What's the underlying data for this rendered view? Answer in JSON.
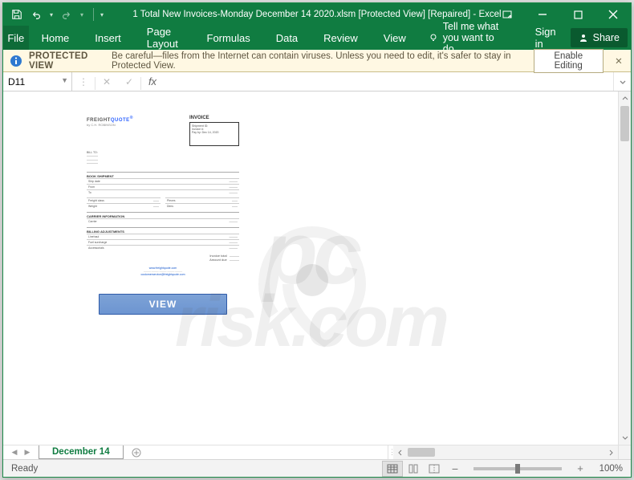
{
  "titlebar": {
    "title": "1 Total New Invoices-Monday December 14 2020.xlsm  [Protected View] [Repaired] - Excel"
  },
  "ribbon": {
    "file": "File",
    "tabs": [
      "Home",
      "Insert",
      "Page Layout",
      "Formulas",
      "Data",
      "Review",
      "View"
    ],
    "tell_me": "Tell me what you want to do...",
    "sign_in": "Sign in",
    "share": "Share"
  },
  "protected_view": {
    "strong": "PROTECTED VIEW",
    "message": "Be careful—files from the Internet can contain viruses. Unless you need to edit, it's safer to stay in Protected View.",
    "enable": "Enable Editing"
  },
  "formula": {
    "name_box": "D11",
    "fx": "fx"
  },
  "sheet": {
    "active_tab": "December 14"
  },
  "status": {
    "ready": "Ready",
    "zoom": "100%"
  },
  "document": {
    "logo_a": "FREIGHT",
    "logo_b": "QUOTE",
    "logo_sub": "by C.H. ROBINSON",
    "title": "INVOICE",
    "box_labels": "Shipment ID:\nInvoice #:\nPay by: Dec 14, 2020",
    "view_button": "VIEW"
  },
  "watermark": {
    "line1": "pc",
    "line2": "risk.com"
  },
  "colors": {
    "excel_green": "#107c41",
    "excel_dark": "#0e6b38"
  }
}
